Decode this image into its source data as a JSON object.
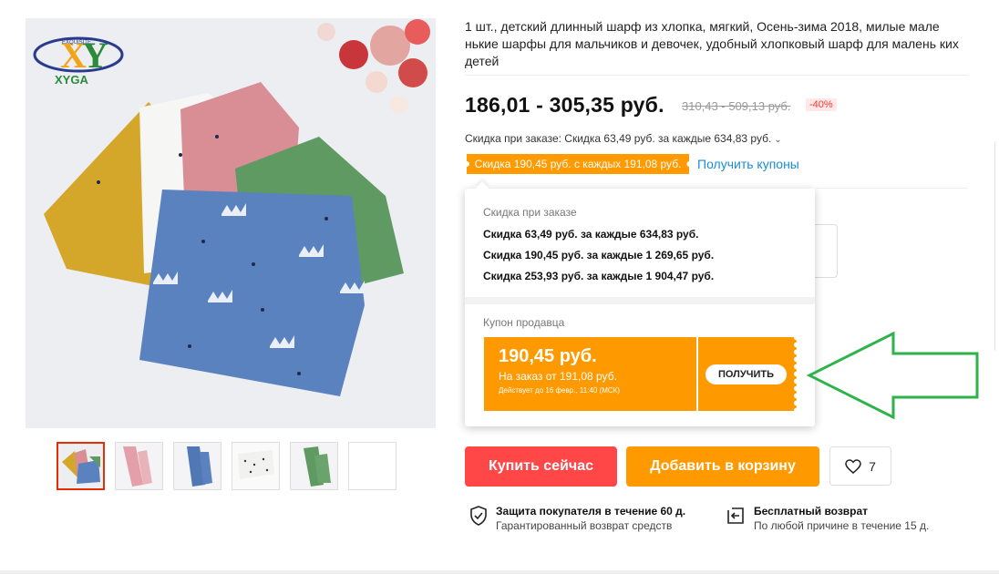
{
  "gallery": {
    "brand_logo_text": "XYGA",
    "brand_logo_small": "EXQUISITE",
    "thumbnails": [
      "thumb-1",
      "thumb-2",
      "thumb-3",
      "thumb-4",
      "thumb-5",
      "thumb-6"
    ]
  },
  "product": {
    "title": "1 шт., детский длинный шарф из хлопка, мягкий, Осень-зима 2018, милые мале нькие шарфы для мальчиков и девочек, удобный хлопковый шарф для малень ких детей",
    "price": "186,01 - 305,35 руб.",
    "old_price": "310,43 - 509,13 руб.",
    "discount": "-40%",
    "bulk_discount": "Скидка при заказе: Скидка 63,49 руб. за каждые 634,83 руб.",
    "coupon_tag": "Скидка 190,45 руб. с каждых 191,08 руб.",
    "get_coupons": "Получить купоны"
  },
  "popup": {
    "bulk_heading": "Скидка при заказе",
    "bulk_rows": [
      "Скидка 63,49 руб. за каждые 634,83 руб.",
      "Скидка 190,45 руб. за каждые 1 269,65 руб.",
      "Скидка 253,93 руб. за каждые 1 904,47 руб."
    ],
    "seller_heading": "Купон продавца",
    "coupon_amount": "190,45 руб.",
    "coupon_min": "На заказ от 191,08 руб.",
    "coupon_valid": "Действует до 16 февр., 11:40 (МСК)",
    "coupon_button": "ПОЛУЧИТЬ"
  },
  "actions": {
    "buy_now": "Купить сейчас",
    "add_to_cart": "Добавить в корзину",
    "wishlist_count": "7"
  },
  "guarantees": [
    {
      "title": "Защита покупателя в течение 60 д.",
      "subtitle": "Гарантированный возврат средств",
      "icon": "shield-check-icon"
    },
    {
      "title": "Бесплатный возврат",
      "subtitle": "По любой причине в течение 15 д.",
      "icon": "return-box-icon"
    }
  ],
  "colors": {
    "buy_now": "#ff4747",
    "add_to_cart": "#ff9900",
    "coupon": "#ff9900",
    "link": "#1a8cd8",
    "annotation_arrow": "#2db34a"
  }
}
